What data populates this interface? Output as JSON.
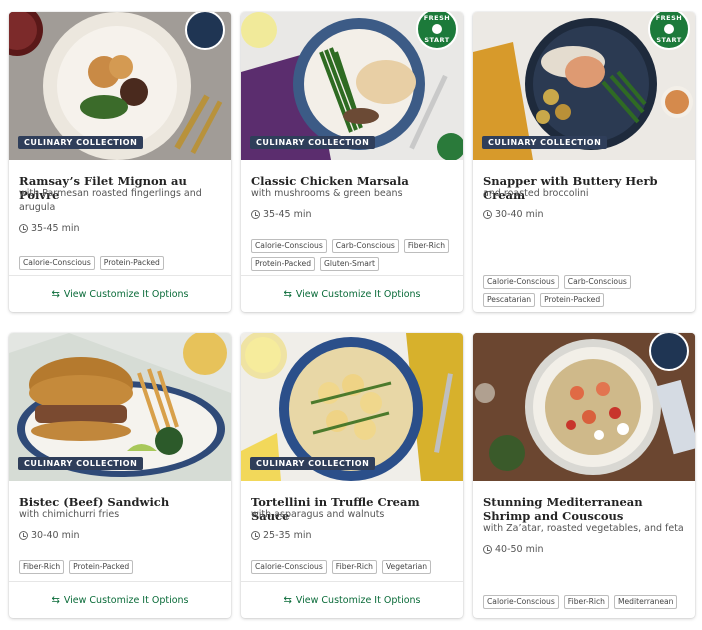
{
  "cards": [
    {
      "title": "Ramsay’s Filet Mignon au Poivre",
      "subtitle": "with Parmesan roasted fingerlings and arugula",
      "time": "35-45 min",
      "badge": "CULINARY COLLECTION",
      "corner": "chef-avatar",
      "tags": [
        "Calorie-Conscious",
        "Protein-Packed"
      ],
      "footer": "View Customize It Options"
    },
    {
      "title": "Classic Chicken Marsala",
      "subtitle": "with mushrooms & green beans",
      "time": "35-45 min",
      "badge": "CULINARY COLLECTION",
      "corner": "fresh-start-badge",
      "tags": [
        "Calorie-Conscious",
        "Carb-Conscious",
        "Fiber-Rich",
        "Protein-Packed",
        "Gluten-Smart"
      ],
      "footer": "View Customize It Options"
    },
    {
      "title": "Snapper with Buttery Herb Cream",
      "subtitle": "and roasted broccolini",
      "time": "30-40 min",
      "badge": "CULINARY COLLECTION",
      "corner": "fresh-start-badge",
      "tags": [
        "Calorie-Conscious",
        "Carb-Conscious",
        "Pescatarian",
        "Protein-Packed"
      ],
      "footer": ""
    },
    {
      "title": "Bistec (Beef) Sandwich",
      "subtitle": "with chimichurri fries",
      "time": "30-40 min",
      "badge": "CULINARY COLLECTION",
      "corner": "",
      "tags": [
        "Fiber-Rich",
        "Protein-Packed"
      ],
      "footer": "View Customize It Options"
    },
    {
      "title": "Tortellini in Truffle Cream Sauce",
      "subtitle": "with asparagus and walnuts",
      "time": "25-35 min",
      "badge": "CULINARY COLLECTION",
      "corner": "",
      "tags": [
        "Calorie-Conscious",
        "Fiber-Rich",
        "Vegetarian"
      ],
      "footer": "View Customize It Options"
    },
    {
      "title": "Stunning Mediterranean Shrimp and Couscous",
      "subtitle": "with Za’atar, roasted vegetables, and feta",
      "time": "40-50 min",
      "badge": "",
      "corner": "chef-avatar",
      "tags": [
        "Calorie-Conscious",
        "Fiber-Rich",
        "Mediterranean"
      ],
      "footer": ""
    }
  ],
  "fresh_badge": {
    "top": "FRESH",
    "bottom": "START"
  },
  "icons": {
    "clock": "clock-icon",
    "swap": "swap-arrows-icon"
  },
  "colors": {
    "accent_green": "#0a6b39",
    "badge_navy": "#2f3e5a"
  }
}
